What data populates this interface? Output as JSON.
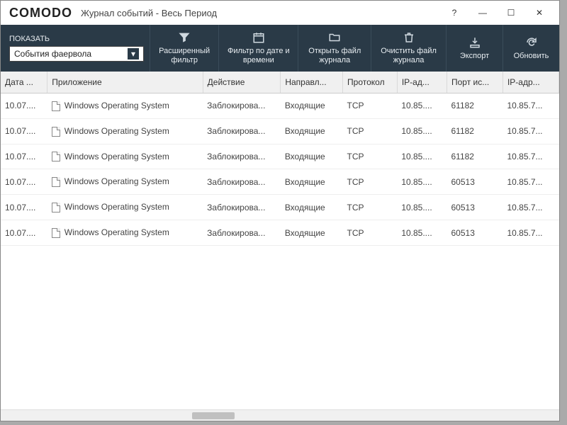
{
  "brand": "COMODO",
  "window_title": "Журнал событий - Весь Период",
  "titlebar_buttons": {
    "help": "?",
    "min": "—",
    "max": "☐",
    "close": "✕"
  },
  "show": {
    "label": "ПОКАЗАТЬ",
    "selected": "События фаервола"
  },
  "tools": [
    {
      "id": "adv-filter",
      "label": "Расширенный фильтр"
    },
    {
      "id": "date-filter",
      "label": "Фильтр по дате и времени"
    },
    {
      "id": "open-log",
      "label": "Открыть файл журнала"
    },
    {
      "id": "clear-log",
      "label": "Очистить файл журнала"
    },
    {
      "id": "export",
      "label": "Экспорт"
    },
    {
      "id": "refresh",
      "label": "Обновить"
    }
  ],
  "columns": [
    "Дата ...",
    "Приложение",
    "Действие",
    "Направл...",
    "Протокол",
    "IP-ад...",
    "Порт ис...",
    "IP-адр..."
  ],
  "rows": [
    {
      "date": "10.07....",
      "app": "Windows Operating System",
      "action": "Заблокирова...",
      "dir": "Входящие",
      "proto": "TCP",
      "src_ip": "10.85....",
      "src_port": "61182",
      "dst_ip": "10.85.7..."
    },
    {
      "date": "10.07....",
      "app": "Windows Operating System",
      "action": "Заблокирова...",
      "dir": "Входящие",
      "proto": "TCP",
      "src_ip": "10.85....",
      "src_port": "61182",
      "dst_ip": "10.85.7..."
    },
    {
      "date": "10.07....",
      "app": "Windows Operating System",
      "action": "Заблокирова...",
      "dir": "Входящие",
      "proto": "TCP",
      "src_ip": "10.85....",
      "src_port": "61182",
      "dst_ip": "10.85.7..."
    },
    {
      "date": "10.07....",
      "app": "Windows Operating System",
      "action": "Заблокирова...",
      "dir": "Входящие",
      "proto": "TCP",
      "src_ip": "10.85....",
      "src_port": "60513",
      "dst_ip": "10.85.7..."
    },
    {
      "date": "10.07....",
      "app": "Windows Operating System",
      "action": "Заблокирова...",
      "dir": "Входящие",
      "proto": "TCP",
      "src_ip": "10.85....",
      "src_port": "60513",
      "dst_ip": "10.85.7..."
    },
    {
      "date": "10.07....",
      "app": "Windows Operating System",
      "action": "Заблокирова...",
      "dir": "Входящие",
      "proto": "TCP",
      "src_ip": "10.85....",
      "src_port": "60513",
      "dst_ip": "10.85.7..."
    }
  ]
}
